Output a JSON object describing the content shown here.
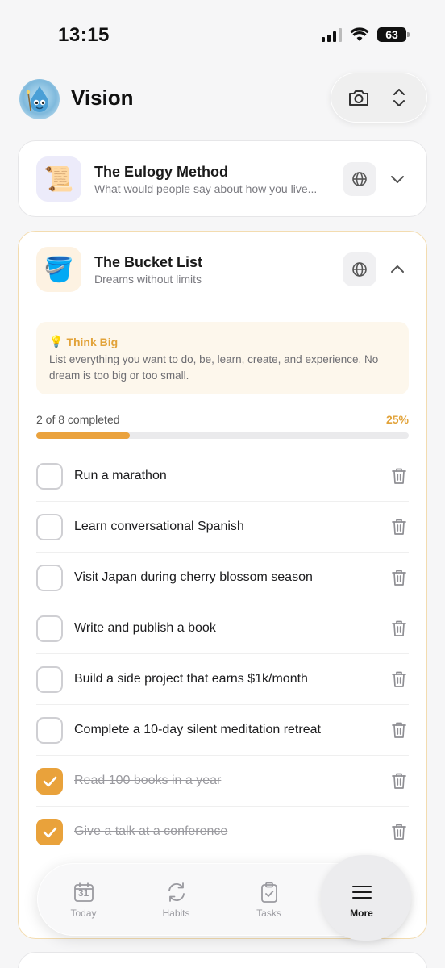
{
  "status_bar": {
    "time": "13:15",
    "battery": "63"
  },
  "header": {
    "title": "Vision",
    "logo_icon": "app-mascot-icon"
  },
  "cards": {
    "eulogy": {
      "emoji": "📜",
      "title": "The Eulogy Method",
      "subtitle": "What would people say about how you live..."
    },
    "bucket": {
      "emoji": "🪣",
      "title": "The Bucket List",
      "subtitle": "Dreams without limits",
      "tip": {
        "icon": "💡",
        "title": "Think Big",
        "body": "List everything you want to do, be, learn, create, and experience. No dream is too big or too small."
      },
      "progress": {
        "label": "2 of 8 completed",
        "percent_label": "25%",
        "fraction": 0.25
      },
      "items": [
        {
          "text": "Run a marathon",
          "done": false
        },
        {
          "text": "Learn conversational Spanish",
          "done": false
        },
        {
          "text": "Visit Japan during cherry blossom season",
          "done": false
        },
        {
          "text": "Write and publish a book",
          "done": false
        },
        {
          "text": "Build a side project that earns $1k/month",
          "done": false
        },
        {
          "text": "Complete a 10-day silent meditation retreat",
          "done": false
        },
        {
          "text": "Read 100 books in a year",
          "done": true
        },
        {
          "text": "Give a talk at a conference",
          "done": true
        }
      ]
    }
  },
  "tab_bar": {
    "tabs": [
      {
        "label": "Today",
        "icon": "calendar-icon",
        "calendar_day": "31",
        "active": false
      },
      {
        "label": "Habits",
        "icon": "refresh-icon",
        "active": false
      },
      {
        "label": "Tasks",
        "icon": "clipboard-check-icon",
        "active": false
      },
      {
        "label": "More",
        "icon": "menu-icon",
        "active": true
      }
    ]
  },
  "colors": {
    "accent": "#e9a23b",
    "progress_track": "#eaeaec",
    "tip_bg": "#fdf7ec"
  }
}
